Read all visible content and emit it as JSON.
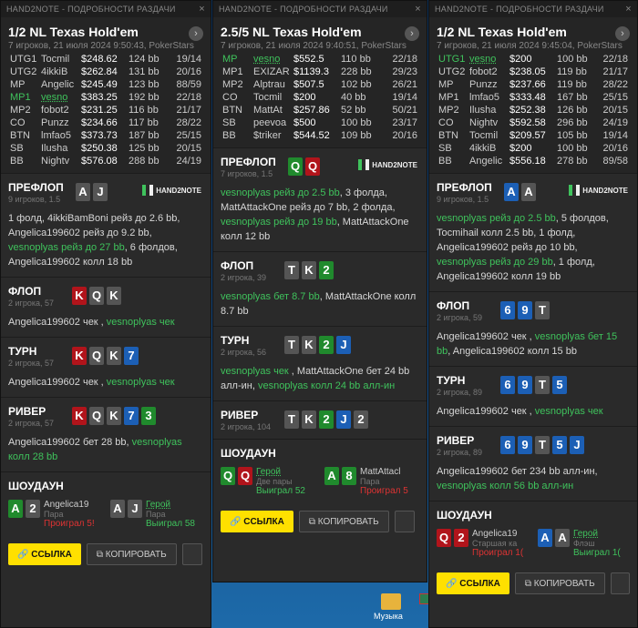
{
  "desktop": {
    "folder_label": "Музыка"
  },
  "panels": [
    {
      "window_title": "HAND2NOTE - ПОДРОБНОСТИ РАЗДАЧИ",
      "game": "1/2 NL Texas Hold'em",
      "sub": "7 игроков, 21 июля 2024 9:50:43, PokerStars",
      "players": [
        {
          "pos": "UTG1",
          "name": "Tocmil",
          "stack": "$248.62",
          "bb": "124 bb",
          "hands": "19/14",
          "hero": false
        },
        {
          "pos": "UTG2",
          "name": "4ikkiB",
          "stack": "$262.84",
          "bb": "131 bb",
          "hands": "20/16",
          "hero": false
        },
        {
          "pos": "MP",
          "name": "Angelic",
          "stack": "$245.49",
          "bb": "123 bb",
          "hands": "88/59",
          "hero": false
        },
        {
          "pos": "MP1",
          "name": "vesno",
          "stack": "$383.25",
          "bb": "192 bb",
          "hands": "22/18",
          "hero": true
        },
        {
          "pos": "MP2",
          "name": "fobot2",
          "stack": "$231.25",
          "bb": "116 bb",
          "hands": "21/17",
          "hero": false
        },
        {
          "pos": "CO",
          "name": "Punzz",
          "stack": "$234.66",
          "bb": "117 bb",
          "hands": "28/22",
          "hero": false
        },
        {
          "pos": "BTN",
          "name": "lmfao5",
          "stack": "$373.73",
          "bb": "187 bb",
          "hands": "25/15",
          "hero": false
        },
        {
          "pos": "SB",
          "name": "Ilusha",
          "stack": "$250.38",
          "bb": "125 bb",
          "hands": "20/15",
          "hero": false
        },
        {
          "pos": "BB",
          "name": "Nightv",
          "stack": "$576.08",
          "bb": "288 bb",
          "hands": "24/19",
          "hero": false
        }
      ],
      "preflop": {
        "title": "ПРЕФЛОП",
        "sub": "9 игроков, 1.5",
        "cards": [
          {
            "r": "A",
            "s": "s"
          },
          {
            "r": "J",
            "s": "s"
          }
        ],
        "action": [
          [
            "n",
            "1 фолд, 4ikkiBamBoni рейз до 2.6 bb, Angelica199602 рейз до 9.2 bb, "
          ],
          [
            "h",
            "vesnoplyas рейз до 27 bb"
          ],
          [
            "n",
            ", 6 фолдов, Angelica199602 колл 18 bb"
          ]
        ]
      },
      "flop": {
        "title": "ФЛОП",
        "sub": "2 игрока, 57",
        "cards": [
          {
            "r": "K",
            "s": "h"
          },
          {
            "r": "Q",
            "s": "s"
          },
          {
            "r": "K",
            "s": "s"
          }
        ],
        "action": [
          [
            "n",
            "Angelica199602 чек , "
          ],
          [
            "h",
            "vesnoplyas чек"
          ]
        ]
      },
      "turn": {
        "title": "ТУРН",
        "sub": "2 игрока, 57",
        "cards": [
          {
            "r": "K",
            "s": "h"
          },
          {
            "r": "Q",
            "s": "s"
          },
          {
            "r": "K",
            "s": "s"
          },
          {
            "r": "7",
            "s": "d"
          }
        ],
        "action": [
          [
            "n",
            "Angelica199602 чек , "
          ],
          [
            "h",
            "vesnoplyas чек"
          ]
        ]
      },
      "river": {
        "title": "РИВЕР",
        "sub": "2 игрока, 57",
        "cards": [
          {
            "r": "K",
            "s": "h"
          },
          {
            "r": "Q",
            "s": "s"
          },
          {
            "r": "K",
            "s": "s"
          },
          {
            "r": "7",
            "s": "d"
          },
          {
            "r": "3",
            "s": "c"
          }
        ],
        "action": [
          [
            "n",
            "Angelica199602 бет 28 bb, "
          ],
          [
            "h",
            "vesnoplyas колл 28 bb"
          ]
        ]
      },
      "showdown": {
        "title": "ШОУДАУН",
        "players": [
          {
            "cards": [
              {
                "r": "A",
                "s": "c"
              },
              {
                "r": "2",
                "s": "s"
              }
            ],
            "name": "Angelica19",
            "hand": "Пара",
            "result": "Проиграл 5!",
            "win": false,
            "hero": false
          },
          {
            "cards": [
              {
                "r": "A",
                "s": "s"
              },
              {
                "r": "J",
                "s": "s"
              }
            ],
            "name": "Герой",
            "hand": "Пара",
            "result": "Выиграл 58",
            "win": true,
            "hero": true
          }
        ]
      },
      "link_label": "ССЫЛКА",
      "copy_label": "КОПИРОВАТЬ"
    },
    {
      "window_title": "HAND2NOTE - ПОДРОБНОСТИ РАЗДАЧИ",
      "game": "2.5/5 NL Texas Hold'em",
      "sub": "7 игроков, 21 июля 2024 9:40:51, PokerStars",
      "players": [
        {
          "pos": "MP",
          "name": "vesno",
          "stack": "$552.5",
          "bb": "110 bb",
          "hands": "22/18",
          "hero": true
        },
        {
          "pos": "MP1",
          "name": "EXIZAR",
          "stack": "$1139.3",
          "bb": "228 bb",
          "hands": "29/23",
          "hero": false
        },
        {
          "pos": "MP2",
          "name": "Alptrau",
          "stack": "$507.5",
          "bb": "102 bb",
          "hands": "26/21",
          "hero": false
        },
        {
          "pos": "CO",
          "name": "Tocmil",
          "stack": "$200",
          "bb": "40 bb",
          "hands": "19/14",
          "hero": false
        },
        {
          "pos": "BTN",
          "name": "MattAt",
          "stack": "$257.86",
          "bb": "52 bb",
          "hands": "50/21",
          "hero": false
        },
        {
          "pos": "SB",
          "name": "peevoa",
          "stack": "$500",
          "bb": "100 bb",
          "hands": "23/17",
          "hero": false
        },
        {
          "pos": "BB",
          "name": "$triker",
          "stack": "$544.52",
          "bb": "109 bb",
          "hands": "20/16",
          "hero": false
        }
      ],
      "preflop": {
        "title": "ПРЕФЛОП",
        "sub": "7 игроков, 1.5",
        "cards": [
          {
            "r": "Q",
            "s": "c"
          },
          {
            "r": "Q",
            "s": "h"
          }
        ],
        "action": [
          [
            "h",
            "vesnoplyas рейз до 2.5 bb"
          ],
          [
            "n",
            ", 3 фолда, MattAttackOne рейз до 7 bb, 2 фолда, "
          ],
          [
            "h",
            "vesnoplyas рейз до 19 bb"
          ],
          [
            "n",
            ", MattAttackOne колл 12 bb"
          ]
        ]
      },
      "flop": {
        "title": "ФЛОП",
        "sub": "2 игрока, 39",
        "cards": [
          {
            "r": "T",
            "s": "s"
          },
          {
            "r": "K",
            "s": "s"
          },
          {
            "r": "2",
            "s": "c"
          }
        ],
        "action": [
          [
            "h",
            "vesnoplyas бет 8.7 bb"
          ],
          [
            "n",
            ", MattAttackOne колл 8.7 bb"
          ]
        ]
      },
      "turn": {
        "title": "ТУРН",
        "sub": "2 игрока, 56",
        "cards": [
          {
            "r": "T",
            "s": "s"
          },
          {
            "r": "K",
            "s": "s"
          },
          {
            "r": "2",
            "s": "c"
          },
          {
            "r": "J",
            "s": "d"
          }
        ],
        "action": [
          [
            "h",
            "vesnoplyas чек"
          ],
          [
            "n",
            " , MattAttackOne бет 24 bb алл-ин, "
          ],
          [
            "h",
            "vesnoplyas колл 24 bb алл-ин"
          ]
        ]
      },
      "river": {
        "title": "РИВЕР",
        "sub": "2 игрока, 104",
        "cards": [
          {
            "r": "T",
            "s": "s"
          },
          {
            "r": "K",
            "s": "s"
          },
          {
            "r": "2",
            "s": "c"
          },
          {
            "r": "J",
            "s": "d"
          },
          {
            "r": "2",
            "s": "s"
          }
        ],
        "action": []
      },
      "showdown": {
        "title": "ШОУДАУН",
        "players": [
          {
            "cards": [
              {
                "r": "Q",
                "s": "c"
              },
              {
                "r": "Q",
                "s": "h"
              }
            ],
            "name": "Герой",
            "hand": "Две пары",
            "result": "Выиграл 52",
            "win": true,
            "hero": true
          },
          {
            "cards": [
              {
                "r": "A",
                "s": "c"
              },
              {
                "r": "8",
                "s": "c"
              }
            ],
            "name": "MattAttacl",
            "hand": "Пара",
            "result": "Проиграл 5",
            "win": false,
            "hero": false
          }
        ]
      },
      "link_label": "ССЫЛКА",
      "copy_label": "КОПИРОВАТЬ"
    },
    {
      "window_title": "HAND2NOTE - ПОДРОБНОСТИ РАЗДАЧИ",
      "game": "1/2 NL Texas Hold'em",
      "sub": "7 игроков, 21 июля 2024 9:45:04, PokerStars",
      "players": [
        {
          "pos": "UTG1",
          "name": "vesno",
          "stack": "$200",
          "bb": "100 bb",
          "hands": "22/18",
          "hero": true
        },
        {
          "pos": "UTG2",
          "name": "fobot2",
          "stack": "$238.05",
          "bb": "119 bb",
          "hands": "21/17",
          "hero": false
        },
        {
          "pos": "MP",
          "name": "Punzz",
          "stack": "$237.66",
          "bb": "119 bb",
          "hands": "28/22",
          "hero": false
        },
        {
          "pos": "MP1",
          "name": "lmfao5",
          "stack": "$333.48",
          "bb": "167 bb",
          "hands": "25/15",
          "hero": false
        },
        {
          "pos": "MP2",
          "name": "Ilusha",
          "stack": "$252.38",
          "bb": "126 bb",
          "hands": "20/15",
          "hero": false
        },
        {
          "pos": "CO",
          "name": "Nightv",
          "stack": "$592.58",
          "bb": "296 bb",
          "hands": "24/19",
          "hero": false
        },
        {
          "pos": "BTN",
          "name": "Tocmil",
          "stack": "$209.57",
          "bb": "105 bb",
          "hands": "19/14",
          "hero": false
        },
        {
          "pos": "SB",
          "name": "4ikkiB",
          "stack": "$200",
          "bb": "100 bb",
          "hands": "20/16",
          "hero": false
        },
        {
          "pos": "BB",
          "name": "Angelic",
          "stack": "$556.18",
          "bb": "278 bb",
          "hands": "89/58",
          "hero": false
        }
      ],
      "preflop": {
        "title": "ПРЕФЛОП",
        "sub": "9 игроков, 1.5",
        "cards": [
          {
            "r": "A",
            "s": "d"
          },
          {
            "r": "A",
            "s": "s"
          }
        ],
        "action": [
          [
            "h",
            "vesnoplyas рейз до 2.5 bb"
          ],
          [
            "n",
            ", 5 фолдов, Tocmihail колл 2.5 bb, 1 фолд, Angelica199602 рейз до 10 bb, "
          ],
          [
            "h",
            "vesnoplyas рейз до 29 bb"
          ],
          [
            "n",
            ", 1 фолд, Angelica199602 колл 19 bb"
          ]
        ]
      },
      "flop": {
        "title": "ФЛОП",
        "sub": "2 игрока, 59",
        "cards": [
          {
            "r": "6",
            "s": "d"
          },
          {
            "r": "9",
            "s": "d"
          },
          {
            "r": "T",
            "s": "s"
          }
        ],
        "action": [
          [
            "n",
            "Angelica199602 чек , "
          ],
          [
            "h",
            "vesnoplyas бет 15 bb"
          ],
          [
            "n",
            ", Angelica199602 колл 15 bb"
          ]
        ]
      },
      "turn": {
        "title": "ТУРН",
        "sub": "2 игрока, 89",
        "cards": [
          {
            "r": "6",
            "s": "d"
          },
          {
            "r": "9",
            "s": "d"
          },
          {
            "r": "T",
            "s": "s"
          },
          {
            "r": "5",
            "s": "d"
          }
        ],
        "action": [
          [
            "n",
            "Angelica199602 чек , "
          ],
          [
            "h",
            "vesnoplyas чек"
          ]
        ]
      },
      "river": {
        "title": "РИВЕР",
        "sub": "2 игрока, 89",
        "cards": [
          {
            "r": "6",
            "s": "d"
          },
          {
            "r": "9",
            "s": "d"
          },
          {
            "r": "T",
            "s": "s"
          },
          {
            "r": "5",
            "s": "d"
          },
          {
            "r": "J",
            "s": "d"
          }
        ],
        "action": [
          [
            "n",
            "Angelica199602 бет 234 bb алл-ин, "
          ],
          [
            "h",
            "vesnoplyas колл 56 bb алл-ин"
          ]
        ]
      },
      "showdown": {
        "title": "ШОУДАУН",
        "players": [
          {
            "cards": [
              {
                "r": "Q",
                "s": "h"
              },
              {
                "r": "2",
                "s": "h"
              }
            ],
            "name": "Angelica19",
            "hand": "Старшая ка",
            "result": "Проиграл 1(",
            "win": false,
            "hero": false
          },
          {
            "cards": [
              {
                "r": "A",
                "s": "d"
              },
              {
                "r": "A",
                "s": "s"
              }
            ],
            "name": "Герой",
            "hand": "Флэш",
            "result": "Выиграл 1(",
            "win": true,
            "hero": true
          }
        ]
      },
      "link_label": "ССЫЛКА",
      "copy_label": "КОПИРОВАТЬ"
    }
  ],
  "brand": "HAND2NOTE"
}
